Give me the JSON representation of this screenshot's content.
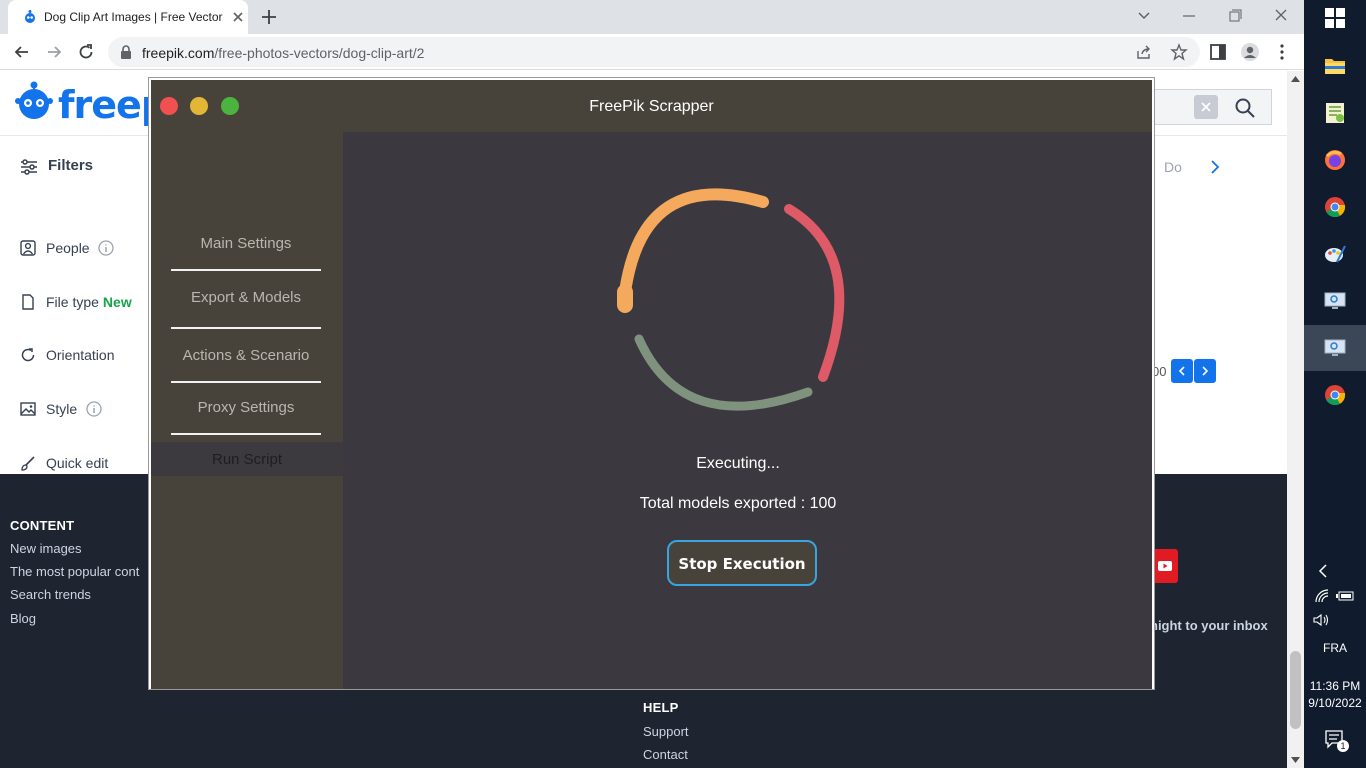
{
  "browser": {
    "tab_title": "Dog Clip Art Images | Free Vector",
    "url_domain": "freepik.com",
    "url_path": "/free-photos-vectors/dog-clip-art/2"
  },
  "freepik": {
    "logo_text": "freep",
    "filters_label": "Filters",
    "sidebar": [
      {
        "label": "People",
        "tag": ""
      },
      {
        "label": "File type",
        "tag": "New"
      },
      {
        "label": "Orientation",
        "tag": ""
      },
      {
        "label": "Style",
        "tag": ""
      },
      {
        "label": "Quick edit",
        "tag": ""
      }
    ],
    "right_fragment": "Do",
    "pager_fragment": "00",
    "footer": {
      "content_heading": "CONTENT",
      "content_links": [
        "New images",
        "The most popular cont",
        "Search trends",
        "Blog"
      ],
      "help_heading": "HELP",
      "help_links": [
        "Support",
        "Contact"
      ],
      "newsletter_fragment": "night to your inbox"
    }
  },
  "app": {
    "title": "FreePik Scrapper",
    "nav": [
      "Main Settings",
      "Export & Models",
      "Actions & Scenario",
      "Proxy Settings"
    ],
    "nav_active": "Run Script",
    "status": "Executing...",
    "total_label": "Total models exported : 100",
    "stop_button": "Stop Execution",
    "colors": {
      "titlebar": "#48433a",
      "content": "#3b393f",
      "arc_orange": "#f5a95c",
      "arc_red": "#dd5a66",
      "arc_green": "#7e927e",
      "button_border": "#38a4e0"
    }
  },
  "taskbar": {
    "language": "FRA",
    "time": "11:36 PM",
    "date": "9/10/2022",
    "notification_count": "1"
  }
}
